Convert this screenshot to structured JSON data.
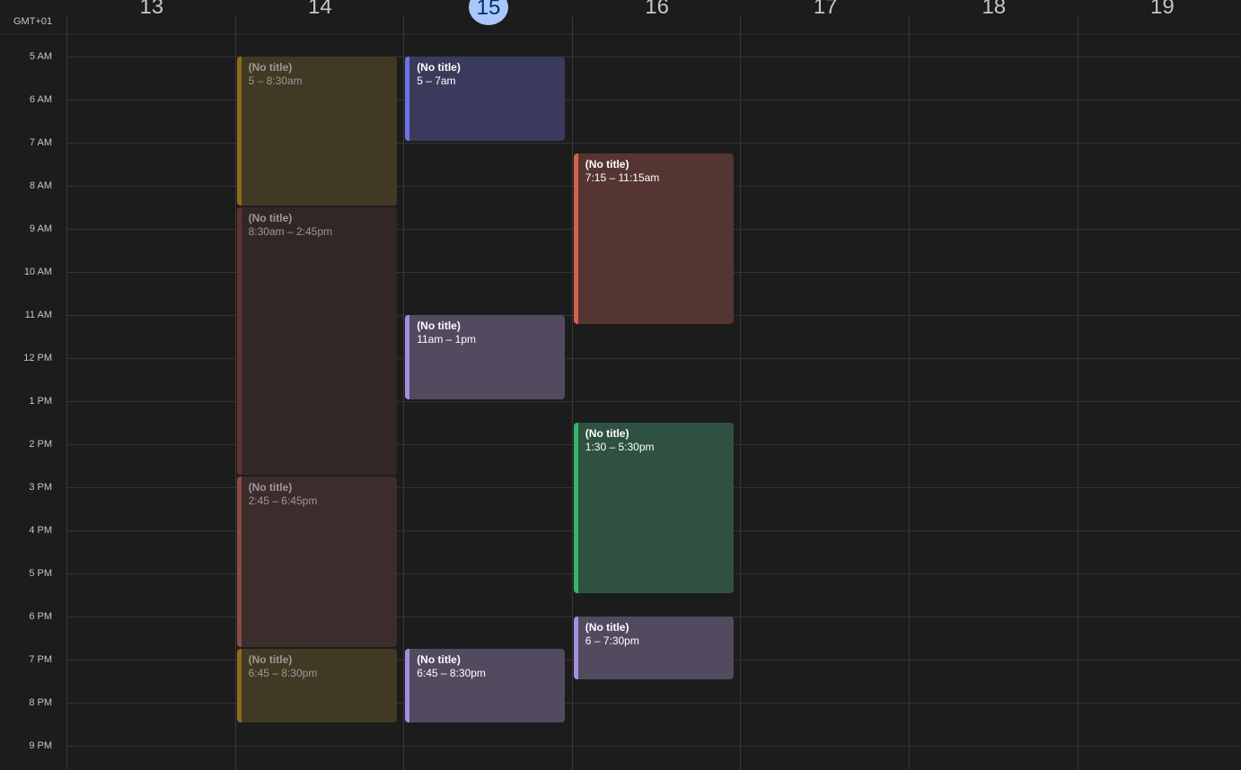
{
  "timezone": "GMT+01",
  "days": [
    {
      "num": "13",
      "today": false
    },
    {
      "num": "14",
      "today": false
    },
    {
      "num": "15",
      "today": true
    },
    {
      "num": "16",
      "today": false
    },
    {
      "num": "17",
      "today": false
    },
    {
      "num": "18",
      "today": false
    },
    {
      "num": "19",
      "today": false
    }
  ],
  "hours": [
    "5 AM",
    "6 AM",
    "7 AM",
    "8 AM",
    "9 AM",
    "10 AM",
    "11 AM",
    "12 PM",
    "1 PM",
    "2 PM",
    "3 PM",
    "4 PM",
    "5 PM",
    "6 PM",
    "7 PM",
    "8 PM",
    "9 PM"
  ],
  "events": [
    {
      "day": 1,
      "start": 5.0,
      "end": 8.5,
      "title": "(No title)",
      "time": "5 – 8:30am",
      "bg": "#413924",
      "accent": "#8c6e1a",
      "past": true
    },
    {
      "day": 1,
      "start": 8.5,
      "end": 14.75,
      "title": "(No title)",
      "time": "8:30am – 2:45pm",
      "bg": "#332725",
      "accent": "#5e3431",
      "past": true
    },
    {
      "day": 1,
      "start": 14.75,
      "end": 18.75,
      "title": "(No title)",
      "time": "2:45 – 6:45pm",
      "bg": "#3d2c2c",
      "accent": "#8a4a45",
      "past": true
    },
    {
      "day": 1,
      "start": 18.75,
      "end": 20.5,
      "title": "(No title)",
      "time": "6:45 – 8:30pm",
      "bg": "#413924",
      "accent": "#8c6e1a",
      "past": true
    },
    {
      "day": 2,
      "start": 5.0,
      "end": 7.0,
      "title": "(No title)",
      "time": "5 – 7am",
      "bg": "#3a3b5c",
      "accent": "#6f72e6",
      "past": false
    },
    {
      "day": 2,
      "start": 11.0,
      "end": 13.0,
      "title": "(No title)",
      "time": "11am – 1pm",
      "bg": "#524a5f",
      "accent": "#a48ee0",
      "past": false
    },
    {
      "day": 2,
      "start": 18.75,
      "end": 20.5,
      "title": "(No title)",
      "time": "6:45 – 8:30pm",
      "bg": "#524a5f",
      "accent": "#a48ee0",
      "past": false
    },
    {
      "day": 3,
      "start": 7.25,
      "end": 11.25,
      "title": "(No title)",
      "time": "7:15 – 11:15am",
      "bg": "#543532",
      "accent": "#d5614b",
      "past": false
    },
    {
      "day": 3,
      "start": 13.5,
      "end": 17.5,
      "title": "(No title)",
      "time": "1:30 – 5:30pm",
      "bg": "#2e5141",
      "accent": "#31b96a",
      "past": false
    },
    {
      "day": 3,
      "start": 18.0,
      "end": 19.5,
      "title": "(No title)",
      "time": "6 – 7:30pm",
      "bg": "#524a5f",
      "accent": "#a48ee0",
      "past": false
    }
  ]
}
